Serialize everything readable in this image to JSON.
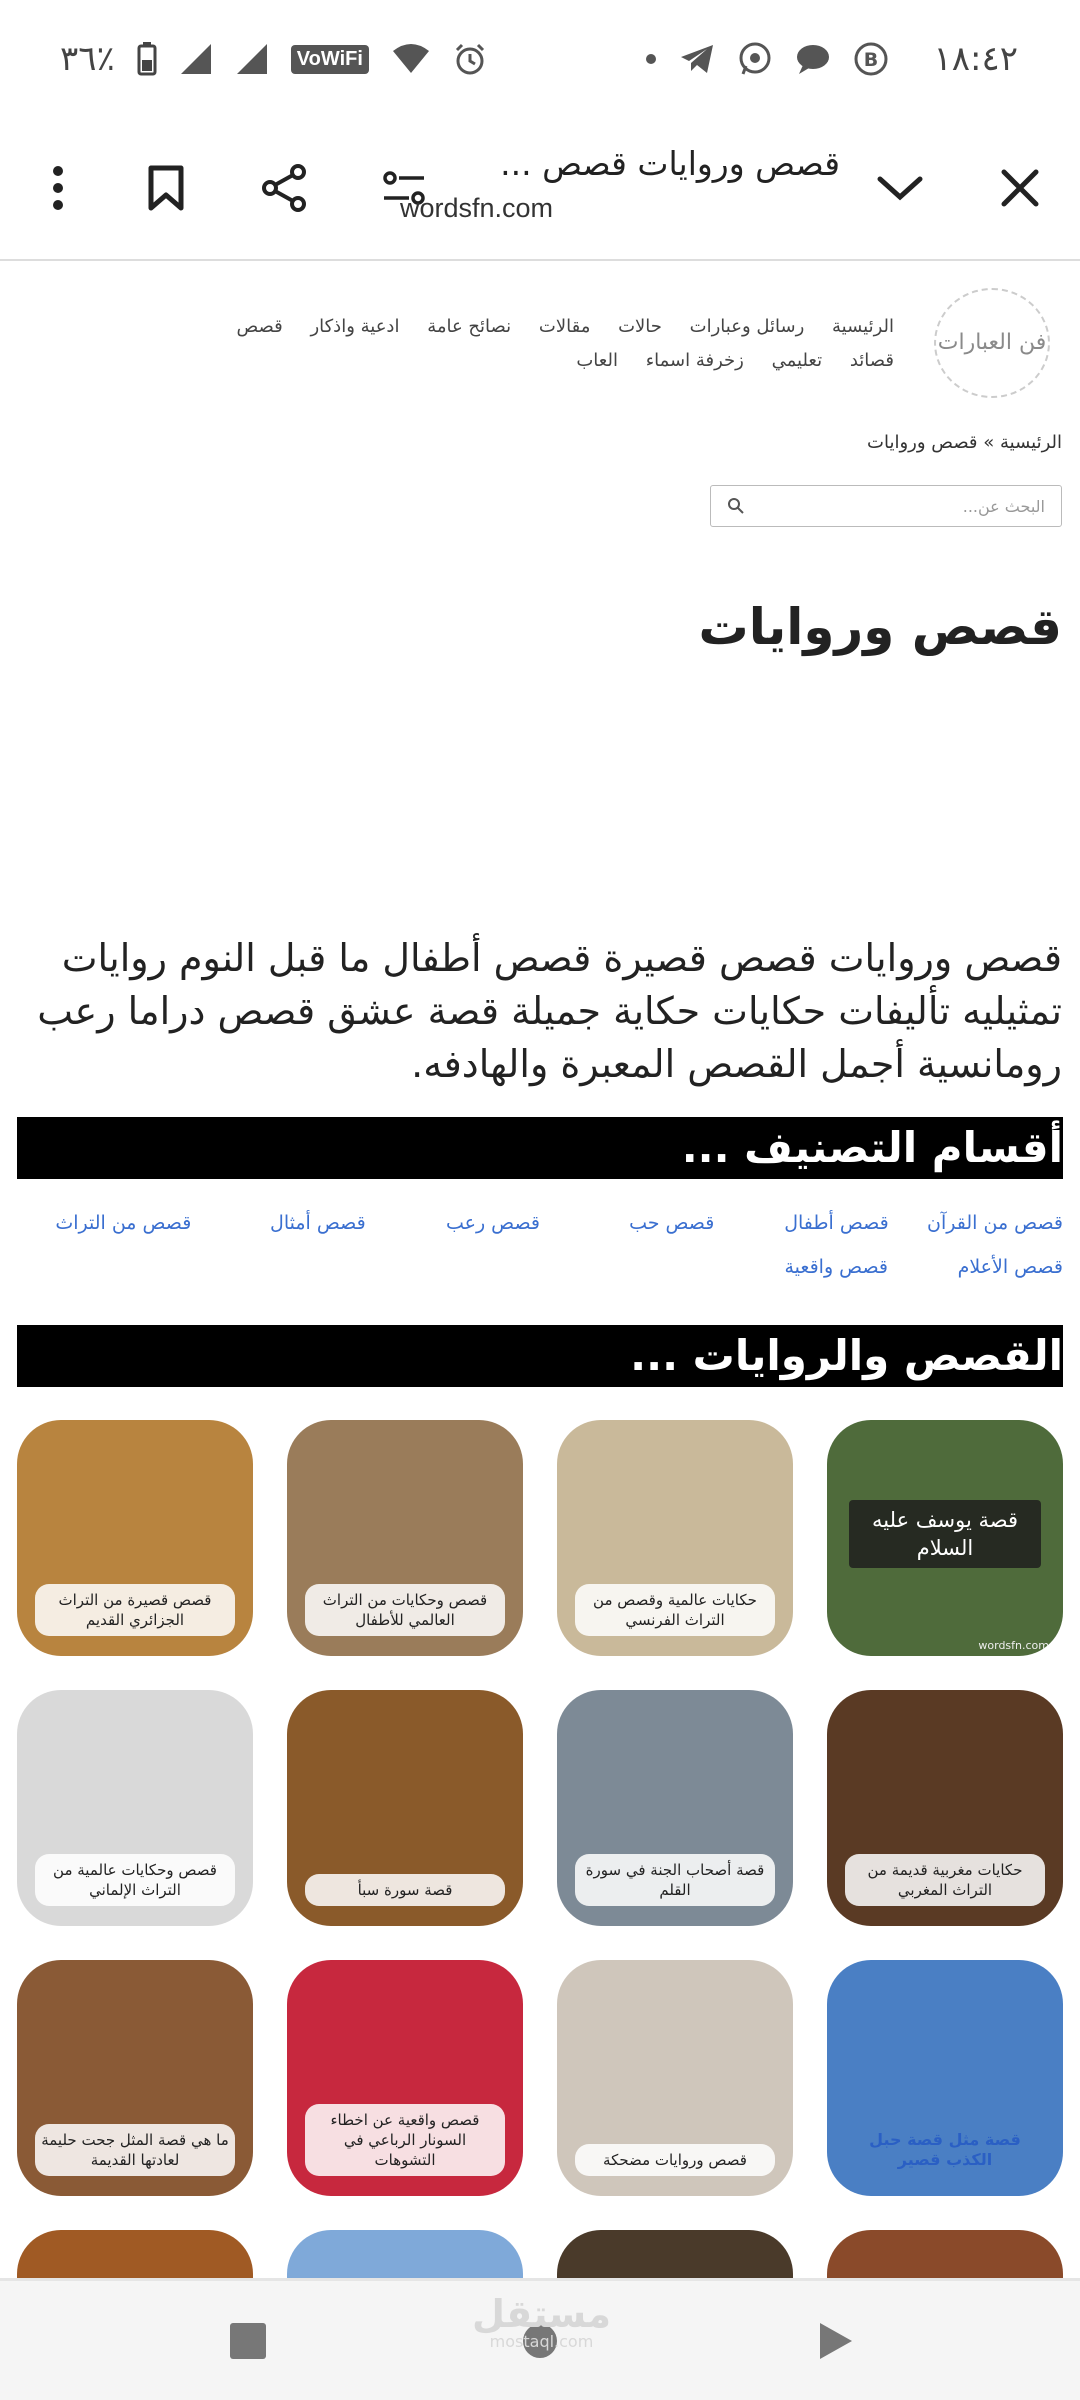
{
  "status": {
    "time": "١٨:٤٢",
    "battery": "٣٦٪",
    "vowifi": "VoWiFi"
  },
  "browser": {
    "title": "قصص وروايات قصص ...",
    "url": "wordsfn.com"
  },
  "site": {
    "logo_text": "فن العبارات",
    "nav": [
      "الرئيسية",
      "رسائل وعبارات",
      "حالات",
      "مقالات",
      "نصائح عامة",
      "ادعية واذكار",
      "قصص",
      "قصائد",
      "تعليمي",
      "زخرفة اسماء",
      "العاب"
    ],
    "breadcrumb": "الرئيسية » قصص وروايات",
    "search_placeholder": "البحث عن..."
  },
  "page": {
    "heading": "قصص وروايات",
    "intro": "قصص وروايات قصص قصيرة قصص أطفال ما قبل النوم روايات تمثيليه تأليفات حكايات حكاية جميلة قصة عشق قصص دراما رعب رومانسية أجمل القصص المعبرة والهادفه.",
    "section_categories": "أقسام التصنيف ...",
    "categories_row1": [
      "قصص من القرآن",
      "قصص أطفال",
      "قصص حب",
      "قصص رعب",
      "قصص أمثال",
      "قصص من التراث"
    ],
    "categories_row2": [
      "قصص الأعلام",
      "قصص واقعية"
    ],
    "section_stories": "القصص والروايات ..."
  },
  "cards": [
    {
      "caption": "قصة يوسف عليه السلام",
      "style": "dark",
      "watermark": "wordsfn.com",
      "bg": "#4f6b3b"
    },
    {
      "caption": "حكايات عالمية وقصص من التراث الفرنسي",
      "style": "plain",
      "bg": "#c9b99a"
    },
    {
      "caption": "قصص وحكايات من التراث العالمي للأطفال",
      "style": "plain",
      "bg": "#9a7c5a"
    },
    {
      "caption": "قصص قصيرة من التراث الجزائري القديم",
      "style": "plain",
      "bg": "#b8843f"
    },
    {
      "caption": "حكايات مغربية قديمة من التراث المغربي",
      "style": "plain",
      "bg": "#5a3a24"
    },
    {
      "caption": "قصة أصحاب الجنة في سورة القلم",
      "style": "plain",
      "bg": "#7d8a96"
    },
    {
      "caption": "قصة سورة سبأ",
      "style": "plain",
      "bg": "#8a5a2a"
    },
    {
      "caption": "قصص وحكايات عالمية من التراث الإلماني",
      "style": "plain",
      "bg": "#d9d9d9"
    },
    {
      "caption": "قصة مثل قصة حبل الكذب قصير",
      "style": "blue",
      "bg": "#4a7fc4"
    },
    {
      "caption": "قصص وروايات مضحكة",
      "style": "plain",
      "bg": "#cfc6bb"
    },
    {
      "caption": "قصص واقعية عن اخطاء السونار الرباعي في التشوهات",
      "style": "plain",
      "bg": "#c7283e"
    },
    {
      "caption": "ما هي قصة المثل جحت حليمة لعادتها القديمة",
      "style": "plain",
      "bg": "#8a5a36"
    }
  ],
  "watermark": {
    "brand": "مستقل",
    "sub": "mostaql.com"
  }
}
